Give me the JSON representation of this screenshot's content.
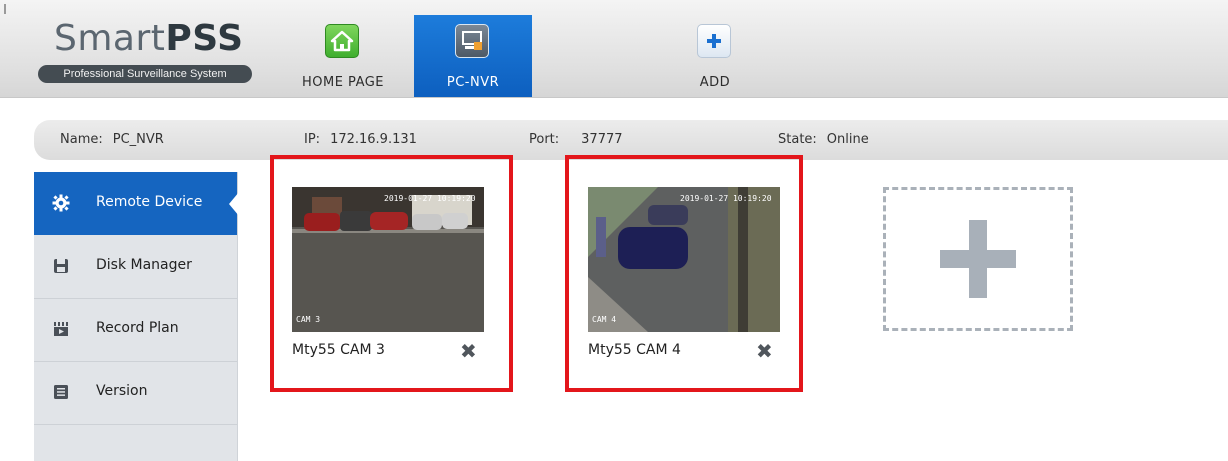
{
  "app": {
    "title_light": "Smart",
    "title_bold": "PSS",
    "subtitle": "Professional Surveillance System"
  },
  "nav": {
    "tabs": [
      {
        "label": "HOME PAGE",
        "icon": "home-icon"
      },
      {
        "label": "PC-NVR",
        "icon": "pc-nvr-icon",
        "active": true
      },
      {
        "label": "ADD",
        "icon": "add-icon"
      }
    ]
  },
  "info": {
    "name_label": "Name:",
    "name_value": "PC_NVR",
    "ip_label": "IP:",
    "ip_value": "172.16.9.131",
    "port_label": "Port:",
    "port_value": "37777",
    "state_label": "State:",
    "state_value": "Online"
  },
  "sidebar": {
    "items": [
      {
        "label": "Remote Device",
        "icon": "gear-icon",
        "active": true
      },
      {
        "label": "Disk Manager",
        "icon": "floppy-disk-icon"
      },
      {
        "label": "Record Plan",
        "icon": "clapperboard-icon"
      },
      {
        "label": "Version",
        "icon": "document-list-icon"
      }
    ]
  },
  "devices": [
    {
      "name": "Mty55 CAM 3",
      "osd_time": "2019-01-27 10:19:20",
      "osd_cam": "CAM 3"
    },
    {
      "name": "Mty55 CAM 4",
      "osd_time": "2019-01-27 10:19:20",
      "osd_cam": "CAM 4"
    }
  ],
  "colors": {
    "accent": "#1565c0",
    "highlight": "#e3161b",
    "sidebar_bg": "#e1e4e8"
  }
}
